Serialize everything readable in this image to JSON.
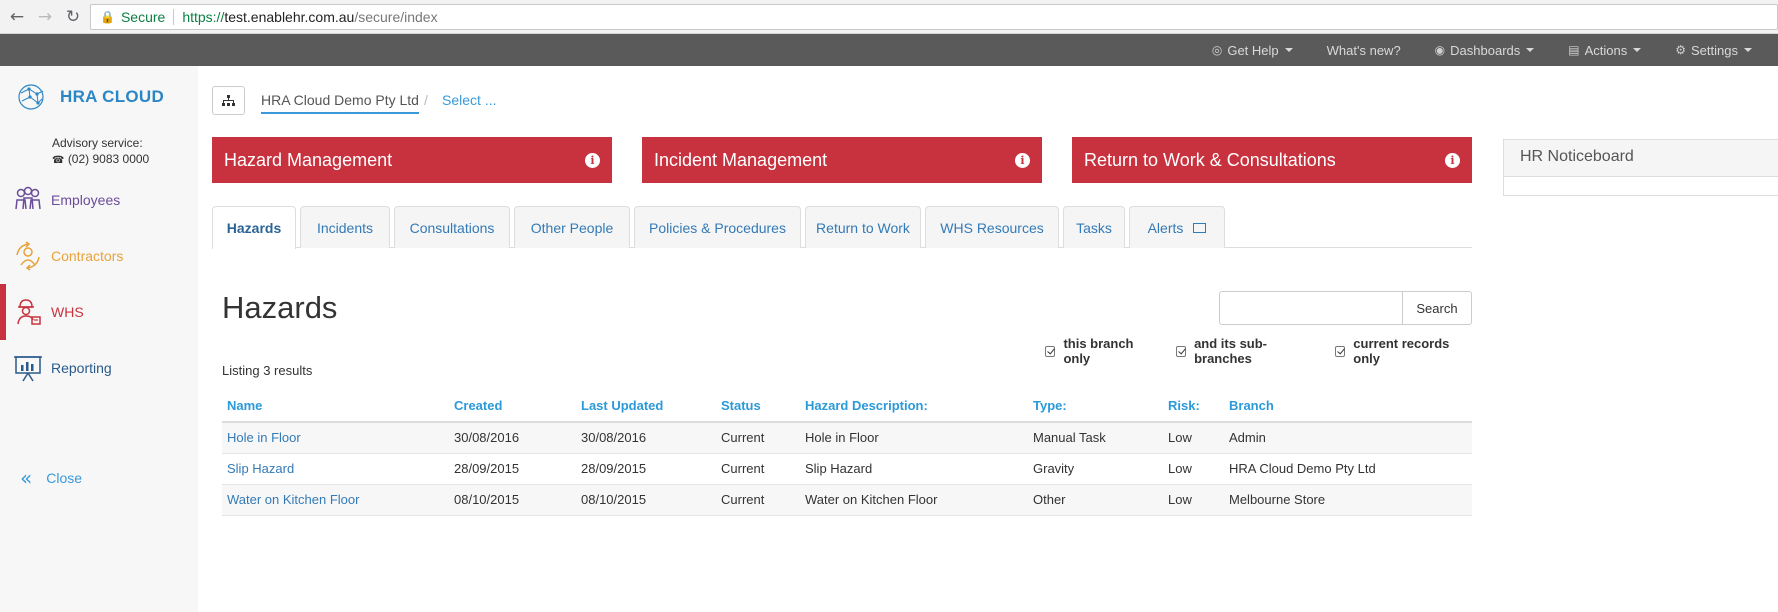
{
  "browser": {
    "back_icon": "arrow-left-icon",
    "forward_icon": "arrow-right-icon",
    "reload_icon": "reload-icon",
    "secure_label": "Secure",
    "url_scheme": "https://",
    "url_host": "test.enablehr.com.au",
    "url_path": "/secure/index"
  },
  "top_nav": {
    "get_help": "Get Help",
    "whats_new": "What's new?",
    "dashboards": "Dashboards",
    "actions": "Actions",
    "settings": "Settings"
  },
  "sidebar": {
    "logo_text": "HRA CLOUD",
    "logo_mark": "·",
    "advisory_label": "Advisory service:",
    "advisory_phone": "(02) 9083 0000",
    "items": [
      {
        "label": "Employees",
        "color": "#6b4c9a",
        "icon": "employees-icon"
      },
      {
        "label": "Contractors",
        "color": "#e8a23a",
        "icon": "contractors-icon"
      },
      {
        "label": "WHS",
        "color": "#c8323f",
        "icon": "whs-icon"
      },
      {
        "label": "Reporting",
        "color": "#2a5a8a",
        "icon": "reporting-icon"
      }
    ],
    "close_label": "Close"
  },
  "breadcrumb": {
    "company": "HRA Cloud Demo Pty Ltd",
    "separator": "/",
    "select": "Select ..."
  },
  "modules": [
    {
      "label": "Hazard Management"
    },
    {
      "label": "Incident Management"
    },
    {
      "label": "Return to Work & Consultations"
    }
  ],
  "noticeboard": {
    "title": "HR Noticeboard"
  },
  "tabs": [
    {
      "label": "Hazards"
    },
    {
      "label": "Incidents"
    },
    {
      "label": "Consultations"
    },
    {
      "label": "Other People"
    },
    {
      "label": "Policies & Procedures"
    },
    {
      "label": "Return to Work"
    },
    {
      "label": "WHS Resources"
    },
    {
      "label": "Tasks"
    },
    {
      "label": "Alerts"
    }
  ],
  "hazards": {
    "title": "Hazards",
    "search_value": "",
    "search_button": "Search",
    "filters": {
      "branch_only": "this branch only",
      "sub_branches": "and its sub-branches",
      "current_only": "current records only"
    },
    "listing": "Listing 3 results",
    "columns": {
      "name": "Name",
      "created": "Created",
      "updated": "Last Updated",
      "status": "Status",
      "description": "Hazard Description:",
      "type": "Type:",
      "risk": "Risk:",
      "branch": "Branch"
    },
    "rows": [
      {
        "name": "Hole in Floor",
        "created": "30/08/2016",
        "updated": "30/08/2016",
        "status": "Current",
        "description": "Hole in Floor",
        "type": "Manual Task",
        "risk": "Low",
        "branch": "Admin"
      },
      {
        "name": "Slip Hazard",
        "created": "28/09/2015",
        "updated": "28/09/2015",
        "status": "Current",
        "description": "Slip Hazard",
        "type": "Gravity",
        "risk": "Low",
        "branch": "HRA Cloud Demo Pty Ltd"
      },
      {
        "name": "Water on Kitchen Floor",
        "created": "08/10/2015",
        "updated": "08/10/2015",
        "status": "Current",
        "description": "Water on Kitchen Floor",
        "type": "Other",
        "risk": "Low",
        "branch": "Melbourne Store"
      }
    ]
  },
  "colors": {
    "accent_red": "#c8323f",
    "link_blue": "#337ab7",
    "header_blue": "#2b9ad9",
    "top_nav_bg": "#5a5a5a"
  }
}
